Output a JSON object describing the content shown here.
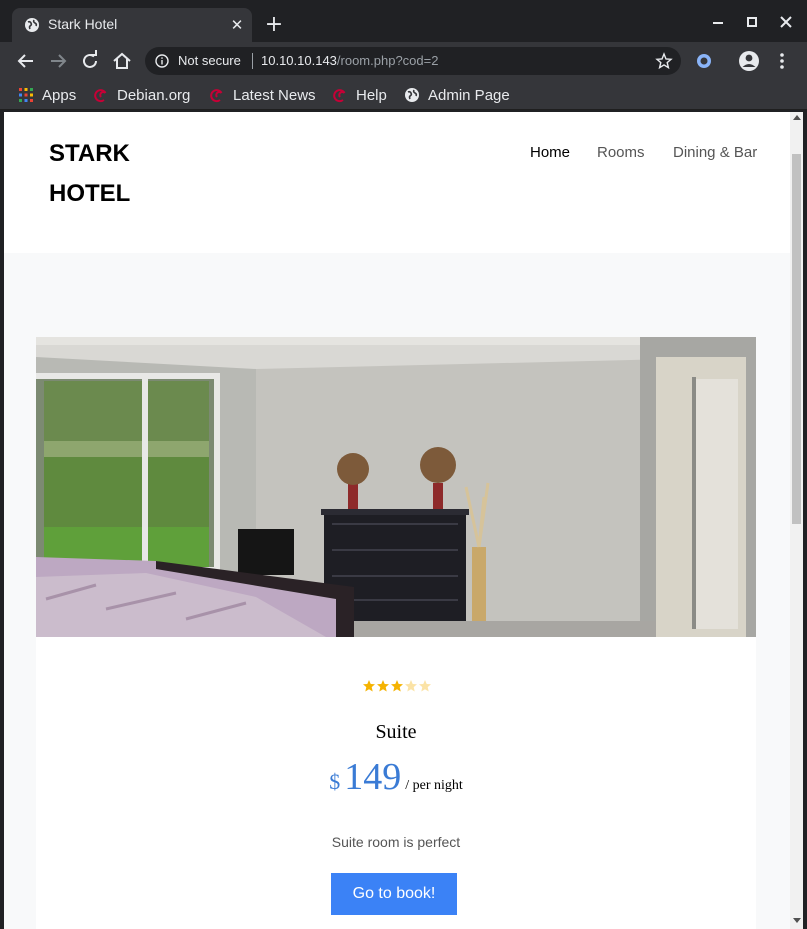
{
  "browser": {
    "tab_title": "Stark Hotel",
    "tab_favicon": "globe-icon",
    "close_tab_icon": "close-icon",
    "new_tab_icon": "plus-icon",
    "window_controls": [
      "minimize-icon",
      "maximize-icon",
      "close-icon"
    ],
    "security_label": "Not secure",
    "url_host": "10.10.10.143",
    "url_path": "/room.php?cod=2",
    "bookmarks": [
      {
        "label": "Apps",
        "icon": "apps-grid-icon"
      },
      {
        "label": "Debian.org",
        "icon": "debian-swirl-icon"
      },
      {
        "label": "Latest News",
        "icon": "debian-swirl-icon"
      },
      {
        "label": "Help",
        "icon": "debian-swirl-icon"
      },
      {
        "label": "Admin Page",
        "icon": "globe-icon"
      }
    ]
  },
  "site": {
    "logo": "STARK HOTEL",
    "nav": [
      {
        "label": "Home",
        "active": true
      },
      {
        "label": "Rooms",
        "active": false
      },
      {
        "label": "Dining & Bar",
        "active": false
      }
    ]
  },
  "room": {
    "rating": 3,
    "rating_max": 5,
    "name": "Suite",
    "currency": "$",
    "price": "149",
    "price_unit": "/ per night",
    "description": "Suite room is perfect",
    "book_label": "Go to book!"
  },
  "colors": {
    "accent": "#3b82f6",
    "price": "#3a7bd5",
    "star": "#f5b301"
  }
}
